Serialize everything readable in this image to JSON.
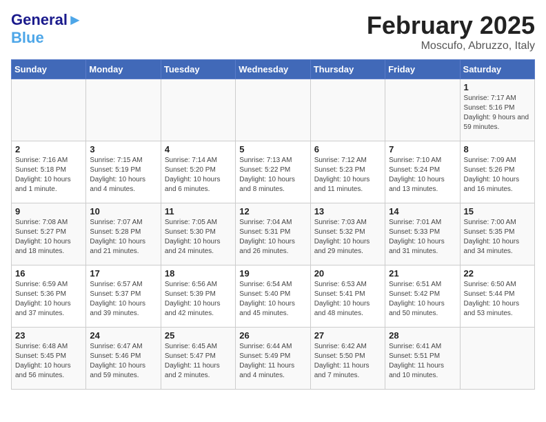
{
  "header": {
    "logo_text1": "General",
    "logo_text2": "Blue",
    "month_year": "February 2025",
    "location": "Moscufo, Abruzzo, Italy"
  },
  "days_of_week": [
    "Sunday",
    "Monday",
    "Tuesday",
    "Wednesday",
    "Thursday",
    "Friday",
    "Saturday"
  ],
  "weeks": [
    [
      {
        "day": "",
        "info": ""
      },
      {
        "day": "",
        "info": ""
      },
      {
        "day": "",
        "info": ""
      },
      {
        "day": "",
        "info": ""
      },
      {
        "day": "",
        "info": ""
      },
      {
        "day": "",
        "info": ""
      },
      {
        "day": "1",
        "info": "Sunrise: 7:17 AM\nSunset: 5:16 PM\nDaylight: 9 hours and 59 minutes."
      }
    ],
    [
      {
        "day": "2",
        "info": "Sunrise: 7:16 AM\nSunset: 5:18 PM\nDaylight: 10 hours and 1 minute."
      },
      {
        "day": "3",
        "info": "Sunrise: 7:15 AM\nSunset: 5:19 PM\nDaylight: 10 hours and 4 minutes."
      },
      {
        "day": "4",
        "info": "Sunrise: 7:14 AM\nSunset: 5:20 PM\nDaylight: 10 hours and 6 minutes."
      },
      {
        "day": "5",
        "info": "Sunrise: 7:13 AM\nSunset: 5:22 PM\nDaylight: 10 hours and 8 minutes."
      },
      {
        "day": "6",
        "info": "Sunrise: 7:12 AM\nSunset: 5:23 PM\nDaylight: 10 hours and 11 minutes."
      },
      {
        "day": "7",
        "info": "Sunrise: 7:10 AM\nSunset: 5:24 PM\nDaylight: 10 hours and 13 minutes."
      },
      {
        "day": "8",
        "info": "Sunrise: 7:09 AM\nSunset: 5:26 PM\nDaylight: 10 hours and 16 minutes."
      }
    ],
    [
      {
        "day": "9",
        "info": "Sunrise: 7:08 AM\nSunset: 5:27 PM\nDaylight: 10 hours and 18 minutes."
      },
      {
        "day": "10",
        "info": "Sunrise: 7:07 AM\nSunset: 5:28 PM\nDaylight: 10 hours and 21 minutes."
      },
      {
        "day": "11",
        "info": "Sunrise: 7:05 AM\nSunset: 5:30 PM\nDaylight: 10 hours and 24 minutes."
      },
      {
        "day": "12",
        "info": "Sunrise: 7:04 AM\nSunset: 5:31 PM\nDaylight: 10 hours and 26 minutes."
      },
      {
        "day": "13",
        "info": "Sunrise: 7:03 AM\nSunset: 5:32 PM\nDaylight: 10 hours and 29 minutes."
      },
      {
        "day": "14",
        "info": "Sunrise: 7:01 AM\nSunset: 5:33 PM\nDaylight: 10 hours and 31 minutes."
      },
      {
        "day": "15",
        "info": "Sunrise: 7:00 AM\nSunset: 5:35 PM\nDaylight: 10 hours and 34 minutes."
      }
    ],
    [
      {
        "day": "16",
        "info": "Sunrise: 6:59 AM\nSunset: 5:36 PM\nDaylight: 10 hours and 37 minutes."
      },
      {
        "day": "17",
        "info": "Sunrise: 6:57 AM\nSunset: 5:37 PM\nDaylight: 10 hours and 39 minutes."
      },
      {
        "day": "18",
        "info": "Sunrise: 6:56 AM\nSunset: 5:39 PM\nDaylight: 10 hours and 42 minutes."
      },
      {
        "day": "19",
        "info": "Sunrise: 6:54 AM\nSunset: 5:40 PM\nDaylight: 10 hours and 45 minutes."
      },
      {
        "day": "20",
        "info": "Sunrise: 6:53 AM\nSunset: 5:41 PM\nDaylight: 10 hours and 48 minutes."
      },
      {
        "day": "21",
        "info": "Sunrise: 6:51 AM\nSunset: 5:42 PM\nDaylight: 10 hours and 50 minutes."
      },
      {
        "day": "22",
        "info": "Sunrise: 6:50 AM\nSunset: 5:44 PM\nDaylight: 10 hours and 53 minutes."
      }
    ],
    [
      {
        "day": "23",
        "info": "Sunrise: 6:48 AM\nSunset: 5:45 PM\nDaylight: 10 hours and 56 minutes."
      },
      {
        "day": "24",
        "info": "Sunrise: 6:47 AM\nSunset: 5:46 PM\nDaylight: 10 hours and 59 minutes."
      },
      {
        "day": "25",
        "info": "Sunrise: 6:45 AM\nSunset: 5:47 PM\nDaylight: 11 hours and 2 minutes."
      },
      {
        "day": "26",
        "info": "Sunrise: 6:44 AM\nSunset: 5:49 PM\nDaylight: 11 hours and 4 minutes."
      },
      {
        "day": "27",
        "info": "Sunrise: 6:42 AM\nSunset: 5:50 PM\nDaylight: 11 hours and 7 minutes."
      },
      {
        "day": "28",
        "info": "Sunrise: 6:41 AM\nSunset: 5:51 PM\nDaylight: 11 hours and 10 minutes."
      },
      {
        "day": "",
        "info": ""
      }
    ]
  ]
}
